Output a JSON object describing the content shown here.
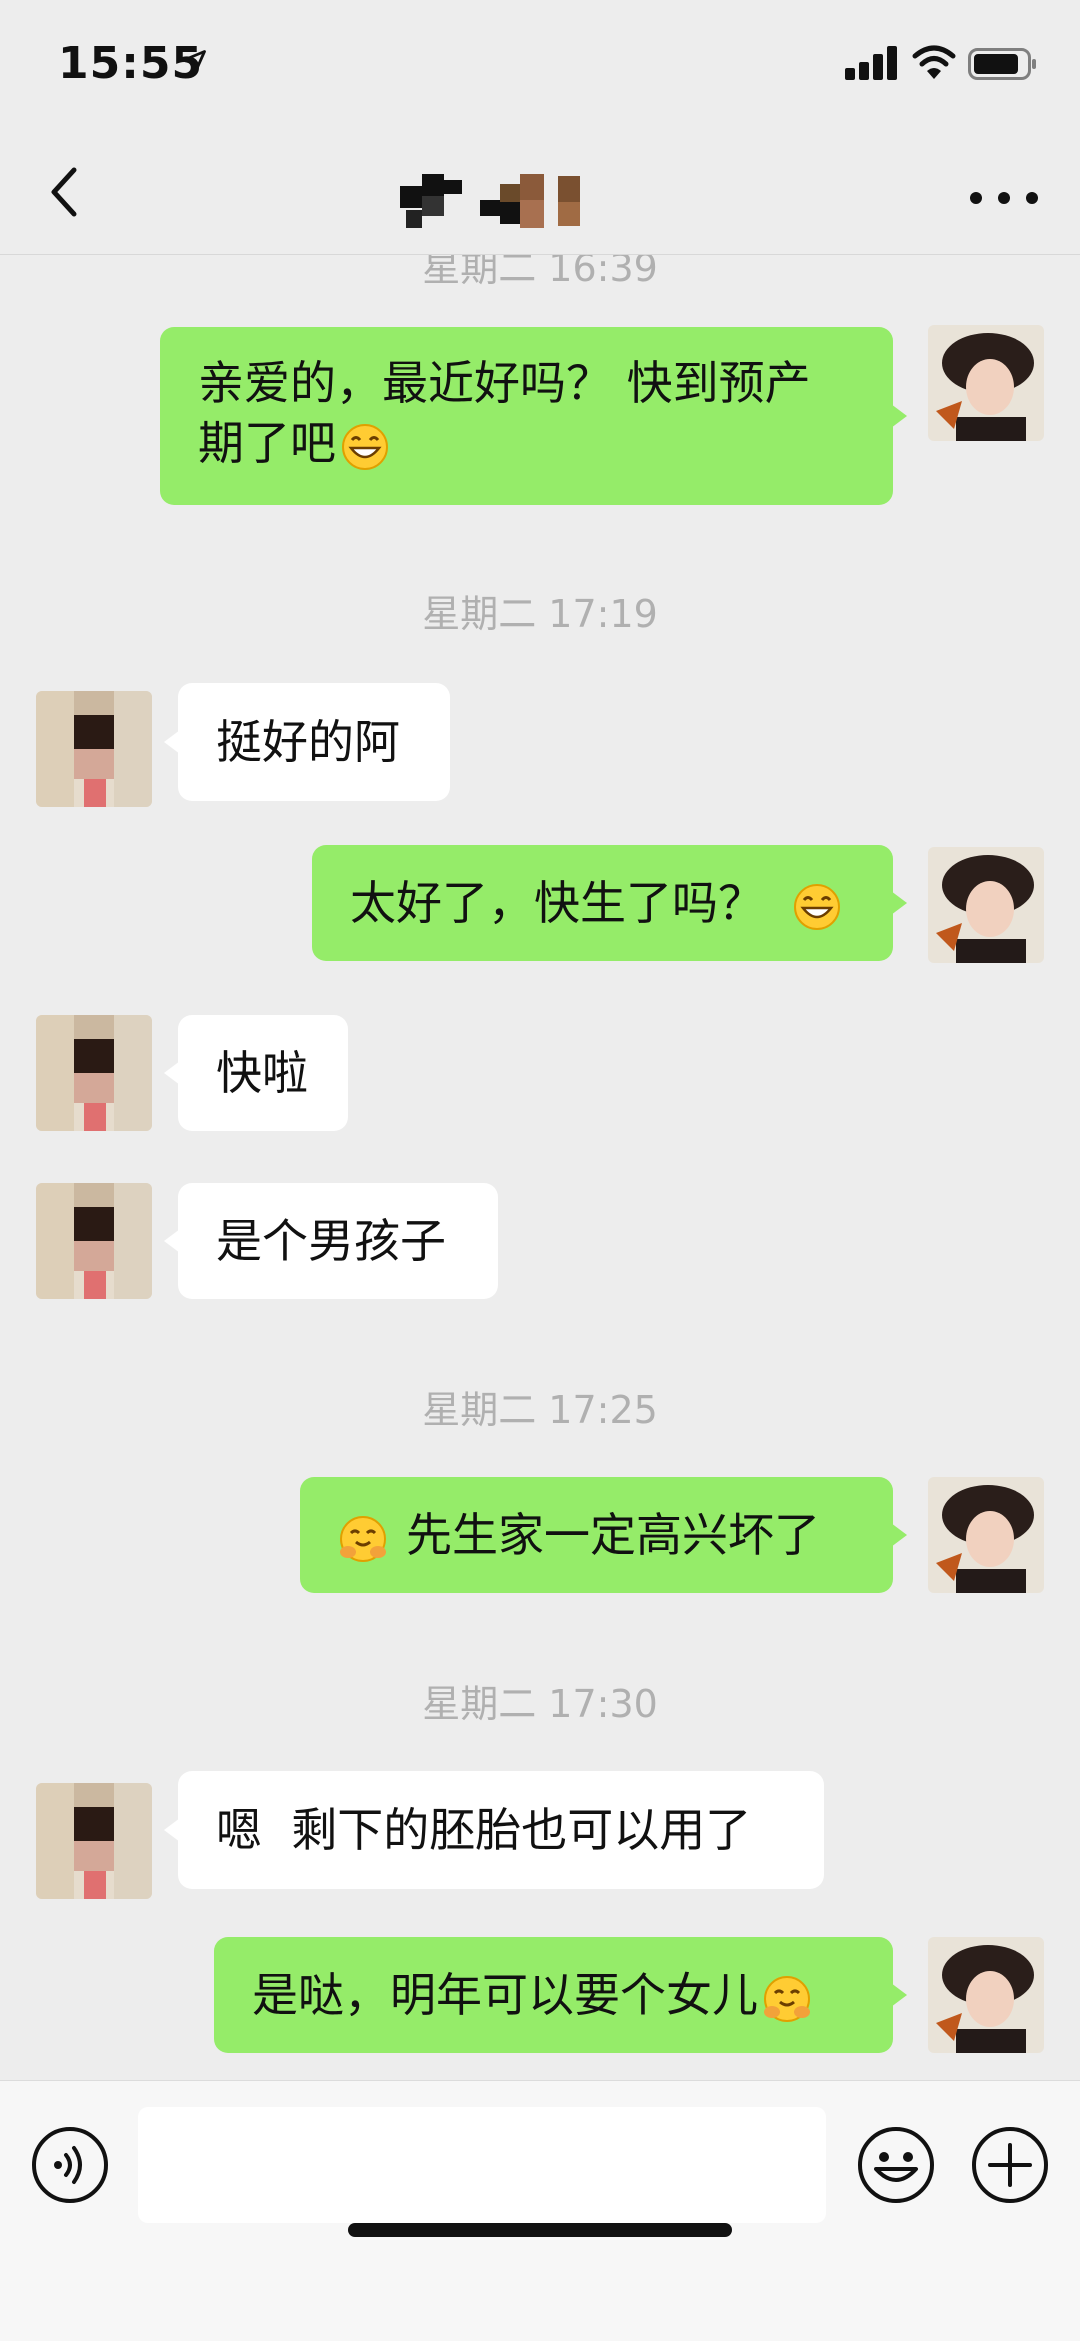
{
  "status_bar": {
    "time": "15:55"
  },
  "nav": {
    "title": ""
  },
  "messages": [
    {
      "type": "timestamp",
      "text": "星期二 16:39"
    },
    {
      "type": "message",
      "side": "me",
      "text": "亲爱的，最近好吗？ 快到预产期了吧",
      "emoji": "grin-emoji"
    },
    {
      "type": "timestamp",
      "text": "星期二 17:19"
    },
    {
      "type": "message",
      "side": "other",
      "text": "挺好的阿"
    },
    {
      "type": "message",
      "side": "me",
      "text": "太好了，快生了吗？",
      "emoji": "grin-emoji"
    },
    {
      "type": "message",
      "side": "other",
      "text": "快啦"
    },
    {
      "type": "message",
      "side": "other",
      "text": "是个男孩子"
    },
    {
      "type": "timestamp",
      "text": "星期二 17:25"
    },
    {
      "type": "message",
      "side": "me",
      "text": "先生家一定高兴坏了",
      "emoji": "hug-emoji"
    },
    {
      "type": "timestamp",
      "text": "星期二 17:30"
    },
    {
      "type": "message",
      "side": "other",
      "text": "嗯  剩下的胚胎也可以用了"
    },
    {
      "type": "message",
      "side": "me",
      "text": "是哒，明年可以要个女儿",
      "emoji": "hug-emoji"
    }
  ],
  "input": {
    "value": "",
    "placeholder": ""
  },
  "icons": {
    "back": "back-chevron-icon",
    "more": "more-dots-icon",
    "voice": "voice-icon",
    "emoji": "emoji-face-icon",
    "plus": "plus-icon"
  },
  "colors": {
    "background": "#ededed",
    "my_bubble": "#95ec69",
    "other_bubble": "#ffffff",
    "timestamp": "#b0b0b0"
  }
}
